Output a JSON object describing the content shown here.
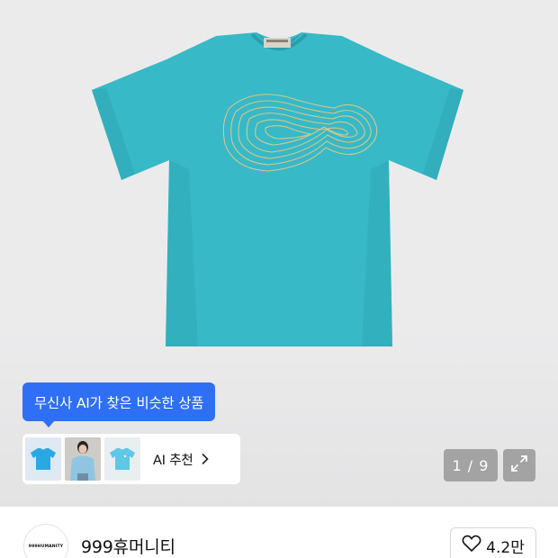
{
  "ai_similar": {
    "tooltip": "무신사 AI가 찾은 비슷한 상품",
    "recommend_label": "AI 추천",
    "thumbnails": [
      "blue-tshirt-thumbnail",
      "model-photo-thumbnail",
      "light-blue-tshirt-thumbnail"
    ]
  },
  "gallery": {
    "current": 1,
    "total": 9,
    "indicator": "1 / 9"
  },
  "brand": {
    "logo_text": "999HUMANITY",
    "name": "999휴머니티",
    "likes": "4.2만"
  },
  "colors": {
    "accent_blue": "#2f6ff5",
    "tshirt": "#37b9c7"
  }
}
